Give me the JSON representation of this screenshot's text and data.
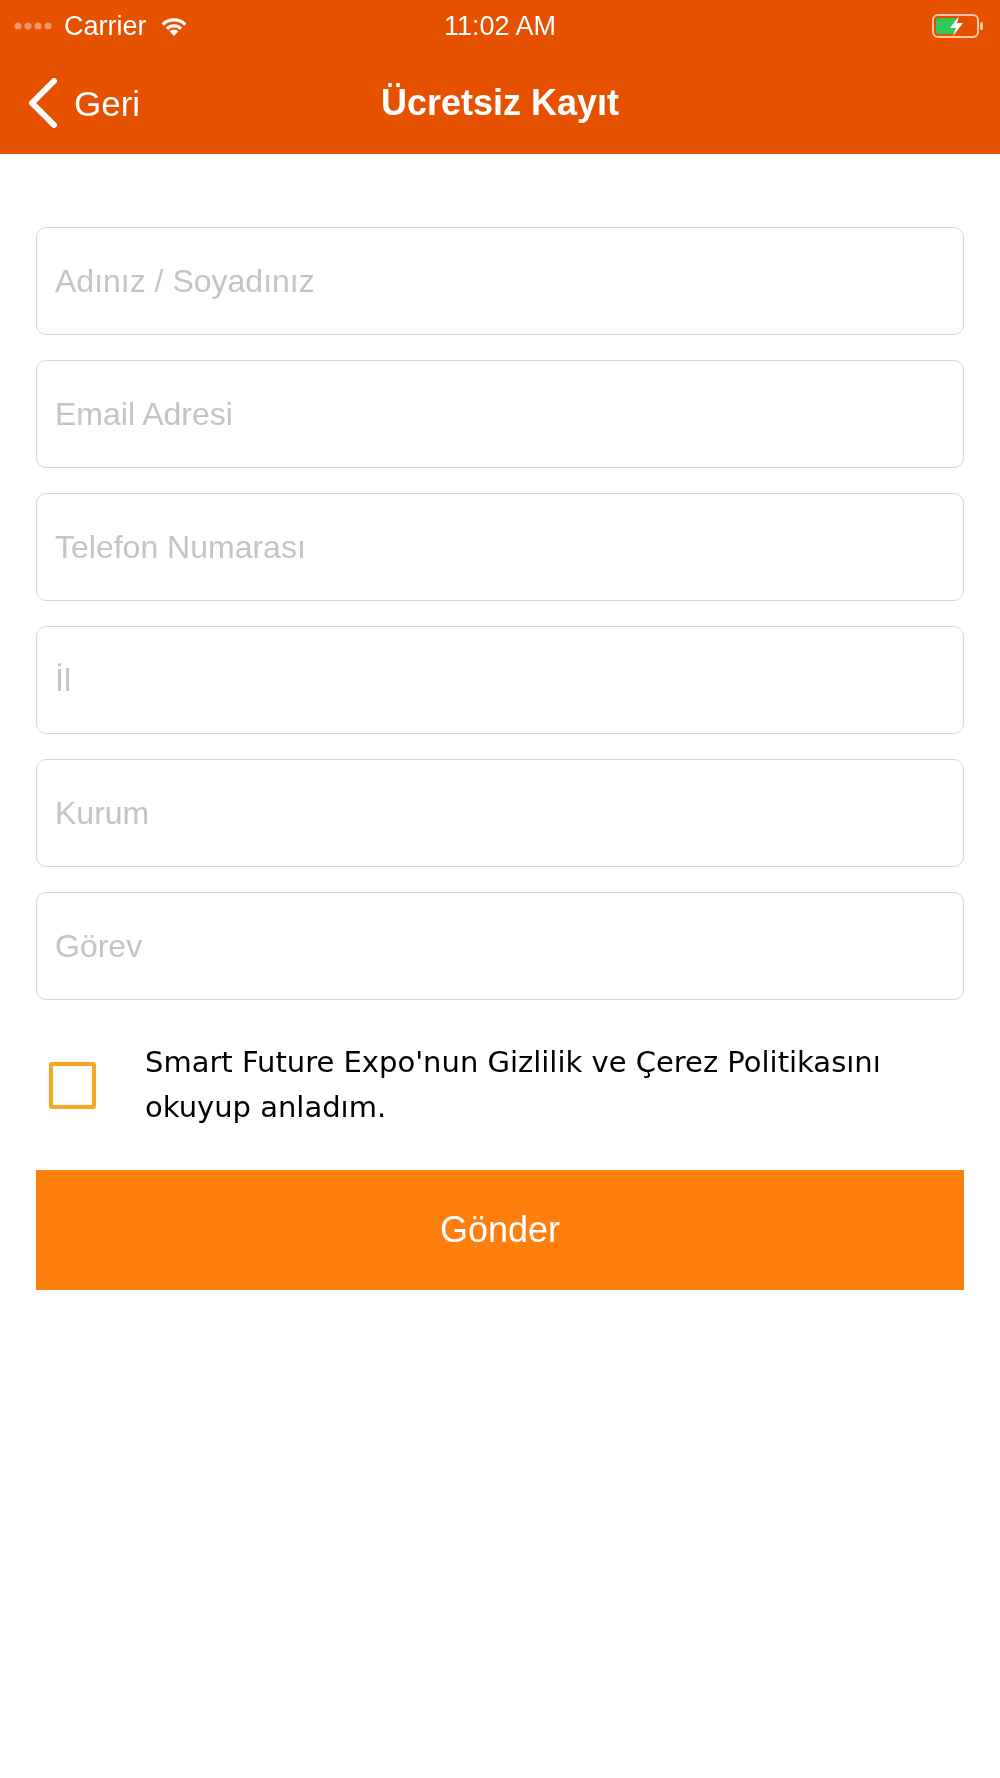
{
  "status_bar": {
    "carrier": "Carrier",
    "time": "11:02 AM"
  },
  "nav_bar": {
    "back_label": "Geri",
    "title": "Ücretsiz Kayıt"
  },
  "form": {
    "fields": [
      {
        "placeholder": "Adınız / Soyadınız"
      },
      {
        "placeholder": "Email Adresi"
      },
      {
        "placeholder": "Telefon Numarası"
      },
      {
        "placeholder": "İl"
      },
      {
        "placeholder": "Kurum"
      },
      {
        "placeholder": "Görev"
      }
    ],
    "consent": {
      "checked": false,
      "text": "Smart Future Expo'nun Gizlilik ve Çerez Politikasını okuyup anladım."
    },
    "submit": {
      "label": "Gönder"
    }
  }
}
